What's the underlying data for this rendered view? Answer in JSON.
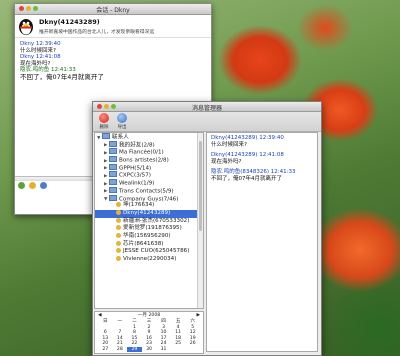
{
  "chat_window": {
    "title": "会话 - Dkny",
    "contact_name": "Dkny(41243289)",
    "signature": "推开新嘉坡中国作品的台北人儿，才发现亲眼看得深远",
    "messages": [
      {
        "header": "Dkny  12:39:40",
        "text": "什么时候回来?",
        "kind": "other"
      },
      {
        "header": "Dkny  12:41:08",
        "text": "现在海外吗?",
        "kind": "other"
      },
      {
        "header": "隐农.鸣的鱼  12:41:33",
        "text": "不回了，俺07年4月就离开了",
        "kind": "self"
      }
    ]
  },
  "manager_window": {
    "title": "消息管理器",
    "toolbar": {
      "delete_label": "删除",
      "export_label": "导出"
    },
    "tree": [
      {
        "label": "联系人",
        "level": 0,
        "type": "root"
      },
      {
        "label": "我的好友(2/8)",
        "level": 1,
        "type": "group"
      },
      {
        "label": "Ma Fiancée(0/1)",
        "level": 1,
        "type": "group"
      },
      {
        "label": "Bons artistes(2/8)",
        "level": 1,
        "type": "group"
      },
      {
        "label": "GPPH(5/14)",
        "level": 1,
        "type": "group"
      },
      {
        "label": "CXPC(3/57)",
        "level": 1,
        "type": "group"
      },
      {
        "label": "Wealink(1/9)",
        "level": 1,
        "type": "group"
      },
      {
        "label": "Trans Contacts(5/9)",
        "level": 1,
        "type": "group"
      },
      {
        "label": "Company Guys(7/46)",
        "level": 1,
        "type": "group-open"
      },
      {
        "label": "坤(176634)",
        "level": 2,
        "type": "contact"
      },
      {
        "label": "Dkny(41243289)",
        "level": 2,
        "type": "contact",
        "selected": true
      },
      {
        "label": "新疆洲-张杰(670533302)",
        "level": 2,
        "type": "contact"
      },
      {
        "label": "爱新觉罗(191876395)",
        "level": 2,
        "type": "contact"
      },
      {
        "label": "华南(156956290)",
        "level": 2,
        "type": "contact"
      },
      {
        "label": "芯片(8641638)",
        "level": 2,
        "type": "contact"
      },
      {
        "label": "JESSE CUO(625045786)",
        "level": 2,
        "type": "contact"
      },
      {
        "label": "Vivienne(2290034)",
        "level": 2,
        "type": "contact"
      }
    ],
    "calendar": {
      "header": "一月 2008",
      "weekdays": [
        "日",
        "一",
        "二",
        "三",
        "四",
        "五",
        "六"
      ],
      "days": [
        "",
        "",
        "1",
        "2",
        "3",
        "4",
        "5",
        "6",
        "7",
        "8",
        "9",
        "10",
        "11",
        "12",
        "13",
        "14",
        "15",
        "16",
        "17",
        "18",
        "19",
        "20",
        "21",
        "22",
        "23",
        "24",
        "25",
        "26",
        "27",
        "28",
        "29",
        "30",
        "31",
        "",
        ""
      ],
      "today": "29"
    },
    "messages": [
      {
        "header": "Dkny(41243289)  12:39:40",
        "text": "什么时候回来?"
      },
      {
        "header": "Dkny(41243289)  12:41:08",
        "text": "现在海外吗?"
      },
      {
        "header": "隐农.鸣的鱼(8348326)  12:41:33",
        "text": "不回了，俺07年4月就离开了"
      }
    ]
  }
}
